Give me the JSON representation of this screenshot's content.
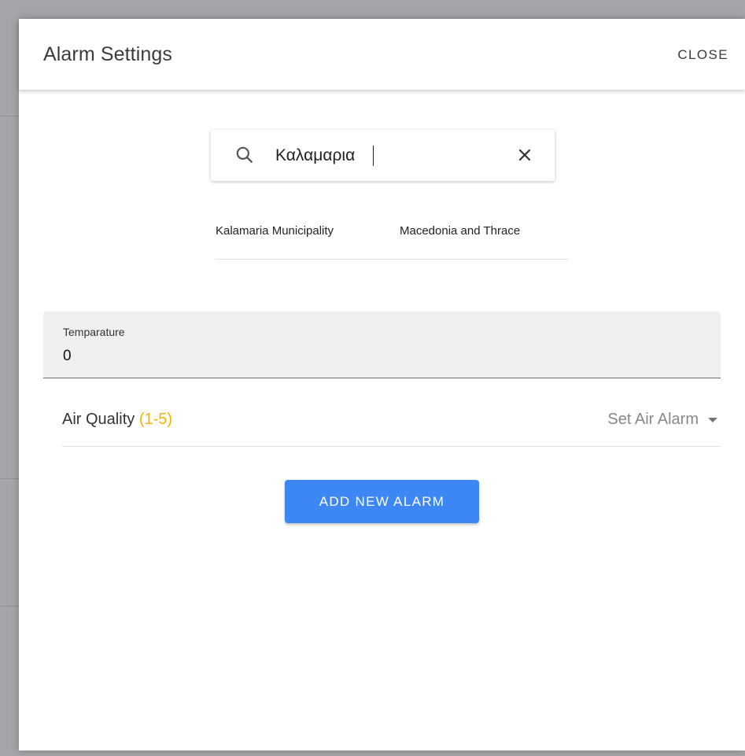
{
  "dialog": {
    "title": "Alarm Settings",
    "close_label": "CLOSE"
  },
  "search": {
    "value": "Καλαμαρια",
    "icon": "search-icon",
    "clear_icon": "close-icon"
  },
  "suggestion": {
    "primary": "Kalamaria Municipality",
    "secondary": "Macedonia and Thrace"
  },
  "temperature": {
    "label": "Temparature",
    "value": "0"
  },
  "air_quality": {
    "label": "Air Quality",
    "range": "(1-5)",
    "select_placeholder": "Set Air Alarm",
    "range_color": "#f5b400"
  },
  "actions": {
    "add_label": "ADD NEW ALARM",
    "accent_color": "#3d87f5"
  }
}
